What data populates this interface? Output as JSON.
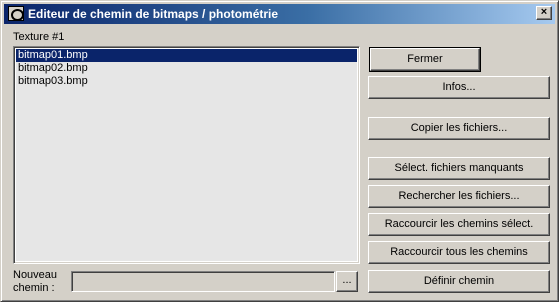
{
  "window": {
    "title": "Editeur de chemin de bitmaps / photométrie",
    "close_label": "×"
  },
  "list": {
    "label": "Texture #1",
    "items": [
      "bitmap01.bmp",
      "bitmap02.bmp",
      "bitmap03.bmp"
    ],
    "selected_index": 0
  },
  "buttons": {
    "close": "Fermer",
    "info": "Infos...",
    "copy_files": "Copier les fichiers...",
    "select_missing": "Sélect. fichiers manquants",
    "find_files": "Rechercher les fichiers...",
    "shorten_selected": "Raccourcir les chemins sélect.",
    "shorten_all": "Raccourcir tous les chemins",
    "set_path": "Définir chemin",
    "browse": "..."
  },
  "new_path": {
    "label_line1": "Nouveau",
    "label_line2": "chemin :",
    "value": ""
  },
  "colors": {
    "titlebar_start": "#0a246a",
    "titlebar_end": "#a6caf0",
    "face": "#d4d0c8",
    "selection": "#0a246a"
  }
}
